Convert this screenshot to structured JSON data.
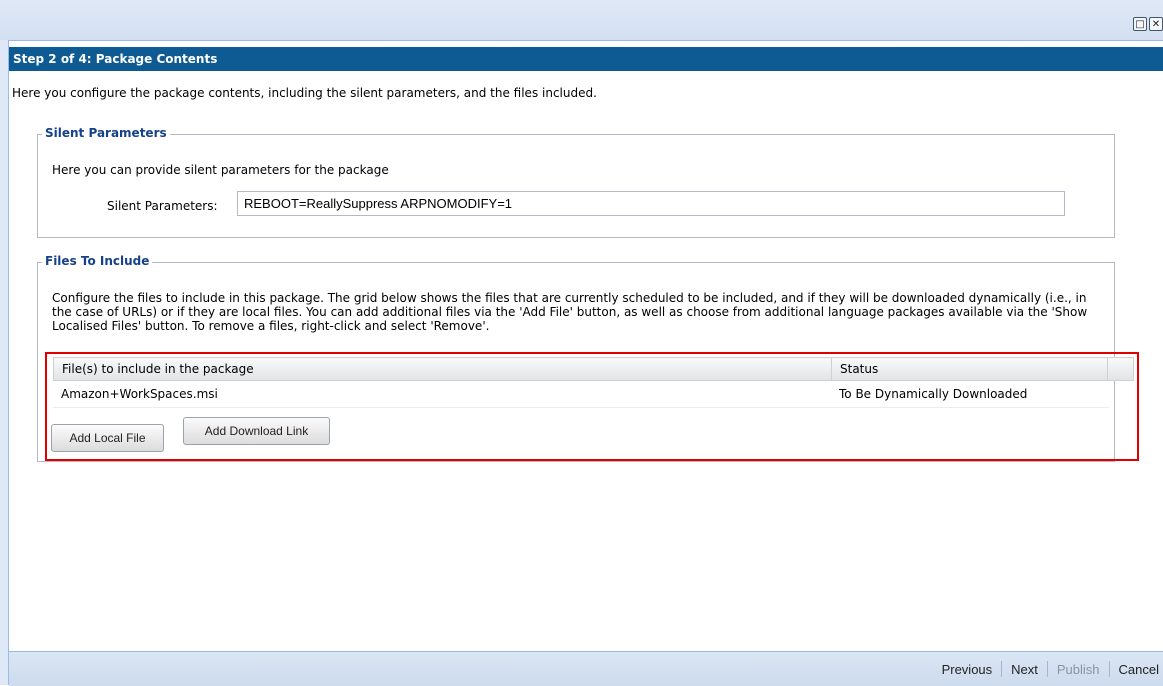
{
  "window": {
    "maximize_glyph": "□",
    "close_glyph": "✕"
  },
  "header": {
    "title": "Step 2 of 4: Package Contents"
  },
  "intro": "Here you configure the package contents, including the silent parameters, and the files included.",
  "silent_parameters": {
    "legend": "Silent Parameters",
    "description": "Here you can provide silent parameters for the package",
    "label": "Silent Parameters:",
    "value": "REBOOT=ReallySuppress ARPNOMODIFY=1"
  },
  "files": {
    "legend": "Files To Include",
    "description": "Configure the files to include in this package. The grid below shows the files that are currently scheduled to be included, and if they will be downloaded dynamically (i.e., in the case of URLs) or if they are local files. You can add additional files via the 'Add File' button, as well as choose from additional language packages available via the 'Show Localised Files' button. To remove a files, right-click and select 'Remove'.",
    "columns": {
      "file": "File(s) to include in the package",
      "status": "Status"
    },
    "rows": [
      {
        "file": "Amazon+WorkSpaces.msi",
        "status": "To Be Dynamically Downloaded"
      }
    ],
    "add_local_label": "Add Local File",
    "add_link_label": "Add Download Link"
  },
  "footer": {
    "previous": "Previous",
    "next": "Next",
    "publish": "Publish",
    "cancel": "Cancel"
  },
  "colors": {
    "header_bg": "#0e5a92",
    "highlight": "#e00000",
    "legend": "#15428b"
  }
}
